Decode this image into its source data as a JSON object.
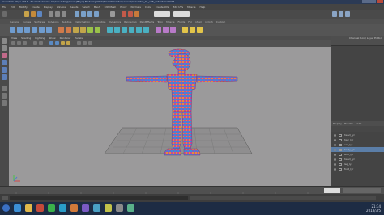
{
  "window": {
    "title": "Autodesk Maya 2013 - Student Version: D:\\Gao Yiding\\Lines (Maya) Modeling Work\\Rise Character\\scenes\\Character_01_v05_untextured.mb*"
  },
  "menubar": {
    "items": [
      "File",
      "Edit",
      "Modify",
      "Create",
      "Display",
      "Window",
      "Assets",
      "Select",
      "Mesh",
      "Edit Mesh",
      "Proxy",
      "Normals",
      "Color",
      "Create UVs",
      "Edit UVs",
      "Muscle",
      "Help"
    ]
  },
  "shelf": {
    "tabs": [
      "General",
      "Curves",
      "Surfaces",
      "Polygons",
      "Subdivs",
      "Deformation",
      "Animation",
      "Dynamics",
      "Rendering",
      "PaintEffects",
      "Toon",
      "Muscle",
      "Fluids",
      "Fur",
      "nHair",
      "nCloth",
      "Custom"
    ]
  },
  "viewport": {
    "menu": [
      "View",
      "Shading",
      "Lighting",
      "Show",
      "Renderer",
      "Panels"
    ]
  },
  "channel_box": {
    "title": "Channel Box / Layer Editor"
  },
  "layers": {
    "tabs": [
      "Display",
      "Render",
      "Anim"
    ],
    "items": [
      {
        "name": "head_lyr",
        "selected": false
      },
      {
        "name": "hair_lyr",
        "selected": false
      },
      {
        "name": "ear_lyr",
        "selected": false
      },
      {
        "name": "body_lyr",
        "selected": true
      },
      {
        "name": "arm_lyr",
        "selected": false
      },
      {
        "name": "hand_lyr",
        "selected": false
      },
      {
        "name": "leg_lyr",
        "selected": false
      },
      {
        "name": "foot_lyr",
        "selected": false
      }
    ]
  },
  "taskbar": {
    "time": "21:34",
    "date": "2013/3/5"
  }
}
